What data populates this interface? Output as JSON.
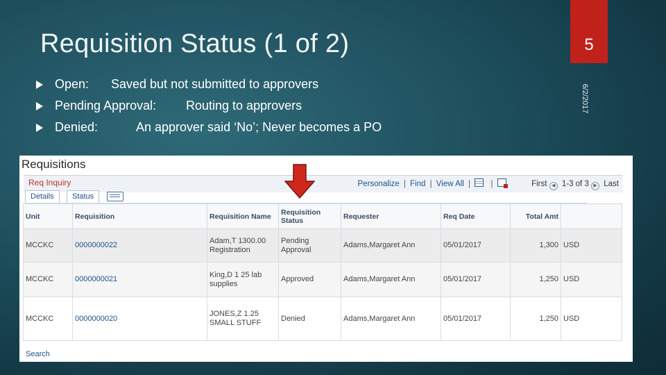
{
  "slide": {
    "title": "Requisition Status  (1 of 2)",
    "page_number": "5",
    "date": "6/2/2017",
    "bullets": [
      {
        "term": "Open:",
        "desc": "Saved but not submitted to approvers"
      },
      {
        "term": "Pending Approval:",
        "desc": "Routing to approvers"
      },
      {
        "term": "Denied:",
        "desc": "An approver said ‘No’; Never becomes a PO"
      }
    ]
  },
  "colors": {
    "accent": "#c0221b",
    "background": "#1e4e5c",
    "link": "#1f4f8b"
  },
  "screenshot": {
    "page_title": "Requisitions",
    "grid_title": "Req Inquiry",
    "actions": {
      "personalize": "Personalize",
      "find": "Find",
      "view_all": "View All",
      "first": "First",
      "range": "1-3 of 3",
      "last": "Last"
    },
    "tabs": [
      "Details",
      "Status"
    ],
    "columns": [
      "Unit",
      "Requisition",
      "Requisition Name",
      "Requisition Status",
      "Requester",
      "Req Date",
      "Total Amt",
      ""
    ],
    "rows": [
      {
        "unit": "MCCKC",
        "requisition": "0000000022",
        "name": "Adam,T 1300.00 Registration",
        "status": "Pending Approval",
        "requester": "Adams,Margaret Ann",
        "date": "05/01/2017",
        "amount": "1,300",
        "currency": "USD"
      },
      {
        "unit": "MCCKC",
        "requisition": "0000000021",
        "name": "King,D 1 25 lab supplies",
        "status": "Approved",
        "requester": "Adams,Margaret Ann",
        "date": "05/01/2017",
        "amount": "1,250",
        "currency": "USD"
      },
      {
        "unit": "MCCKC",
        "requisition": "0000000020",
        "name": "JONES,Z 1.25 SMALL STUFF",
        "status": "Denied",
        "requester": "Adams,Margaret Ann",
        "date": "05/01/2017",
        "amount": "1,250",
        "currency": "USD"
      }
    ],
    "search_label": "Search"
  },
  "icons": {
    "bullet": "triangle-bullet-icon",
    "arrow": "down-arrow-icon"
  }
}
